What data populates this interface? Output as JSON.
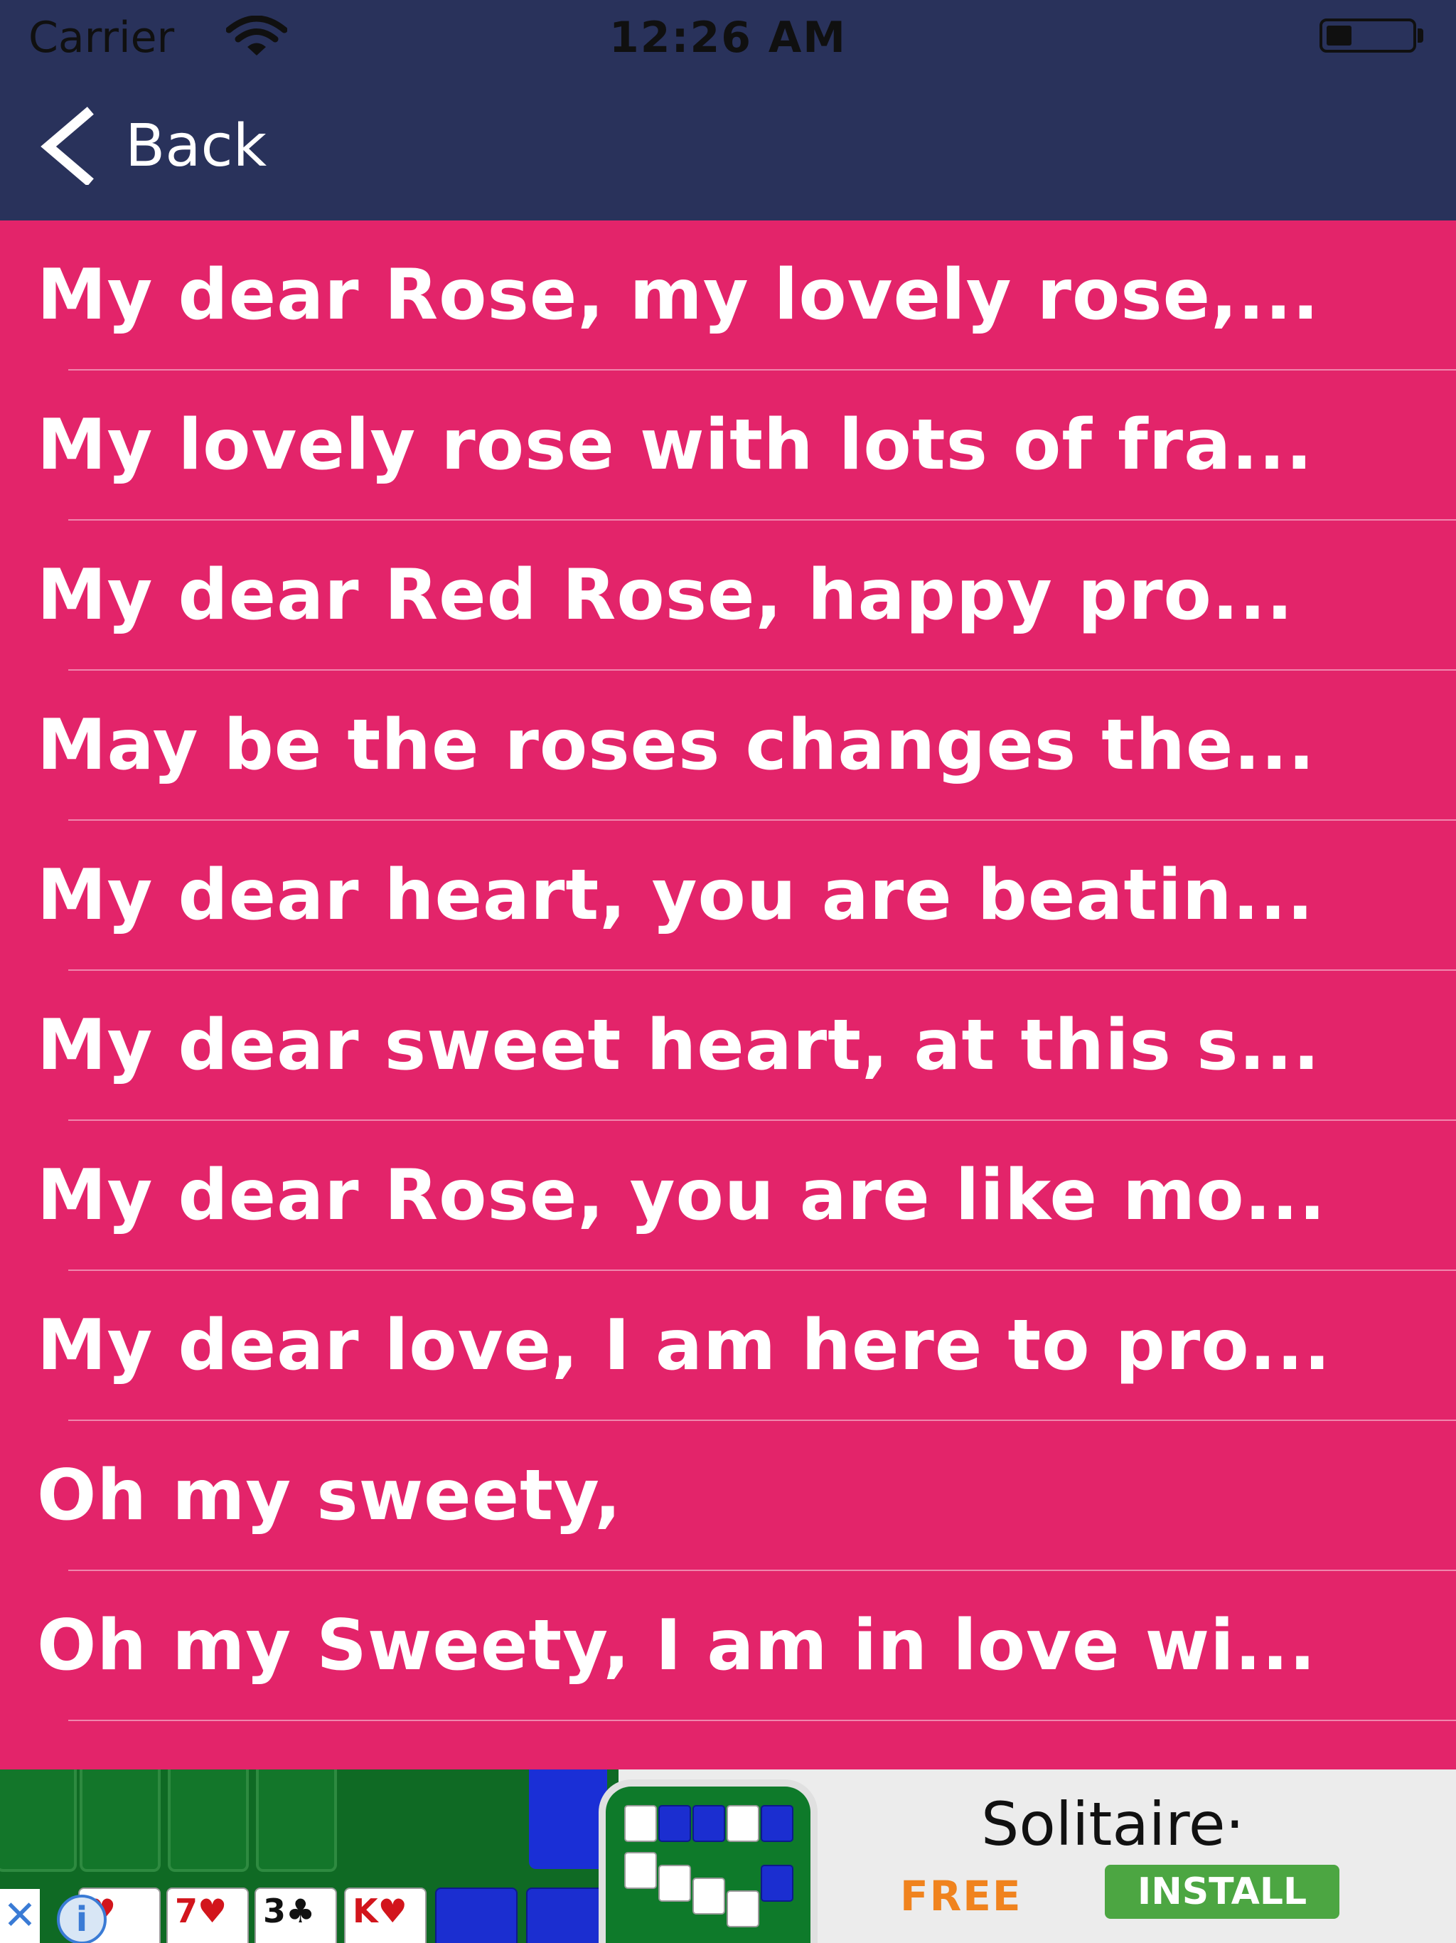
{
  "status_bar": {
    "carrier": "Carrier",
    "time": "12:26 AM",
    "battery_level": 0.3
  },
  "nav": {
    "back_label": "Back",
    "background_color": "#29325B"
  },
  "list": {
    "background_color": "#E3246A",
    "items": [
      "My dear Rose, my lovely rose,...",
      "My lovely rose with lots of fra...",
      "My dear Red Rose, happy pro...",
      "May be the roses changes the...",
      "My dear heart, you are beatin...",
      "My dear sweet heart, at this s...",
      "My dear Rose, you are like mo...",
      "My dear love, I am here to pro...",
      "Oh my sweety,",
      "Oh my Sweety, I am in love wi..."
    ]
  },
  "ad": {
    "title": "Solitaire·",
    "free_label": "FREE",
    "install_label": "INSTALL",
    "close_glyph": "✕",
    "info_glyph": "i",
    "cards": [
      {
        "label": "♥",
        "color": "red"
      },
      {
        "label": "7♥",
        "color": "red"
      },
      {
        "label": "3♣",
        "color": "black"
      },
      {
        "label": "K♥",
        "color": "red"
      }
    ]
  }
}
